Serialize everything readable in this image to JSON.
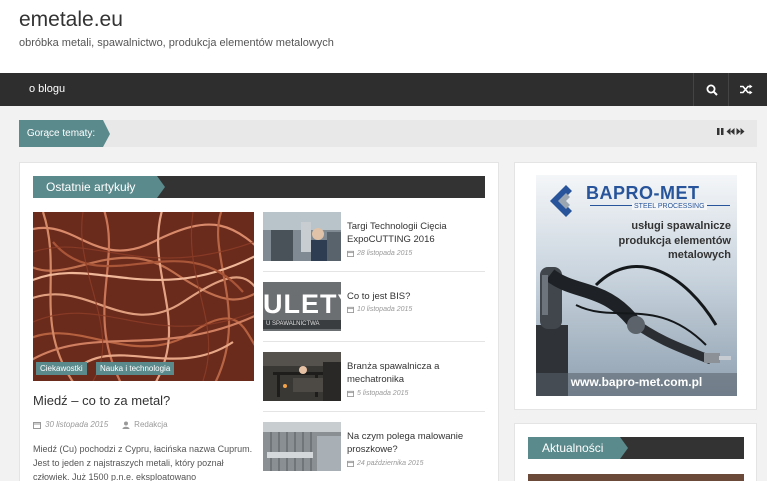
{
  "header": {
    "site_title": "emetale.eu",
    "site_description": "obróbka metali, spawalnictwo, produkcja elementów metalowych"
  },
  "nav": {
    "items": [
      {
        "label": "o blogu"
      }
    ],
    "search_icon": "search-icon",
    "random_icon": "shuffle-icon"
  },
  "ticker": {
    "label": "Gorące tematy:",
    "controls": [
      "pause-icon",
      "prev-icon",
      "next-icon"
    ]
  },
  "main": {
    "section_title": "Ostatnie artykuły",
    "featured": {
      "categories": [
        "Ciekawostki",
        "Nauka i technologia"
      ],
      "title": "Miedź – co to za metal?",
      "date": "30 listopada 2015",
      "author": "Redakcja",
      "excerpt": "Miedź (Cu) pochodzi z Cypru, łacińska nazwa Cuprum. Jest to jeden z najstraszych metali, który poznał człowiek. Już 1500 p.n.e. eksploatowano"
    },
    "posts": [
      {
        "title": "Targi Technologii Cięcia ExpoCUTTING 2016",
        "date": "28 listopada 2015"
      },
      {
        "title": "Co to jest BIS?",
        "date": "10 listopada 2015",
        "thumb_text": "ULETY",
        "thumb_sub": "U SPAWALNICTWA"
      },
      {
        "title": "Branża spawalnicza a mechatronika",
        "date": "5 listopada 2015"
      },
      {
        "title": "Na czym polega malowanie proszkowe?",
        "date": "24 października 2015"
      }
    ]
  },
  "sidebar": {
    "ad": {
      "brand": "BAPRO-MET",
      "tagline": "STEEL PROCESSING",
      "line1": "usługi spawalnicze",
      "line2": "produkcja elementów",
      "line3": "metalowych",
      "url": "www.bapro-met.com.pl"
    },
    "widget_title": "Aktualności"
  },
  "colors": {
    "accent": "#5b8a8c",
    "dark": "#2e2e2e"
  }
}
